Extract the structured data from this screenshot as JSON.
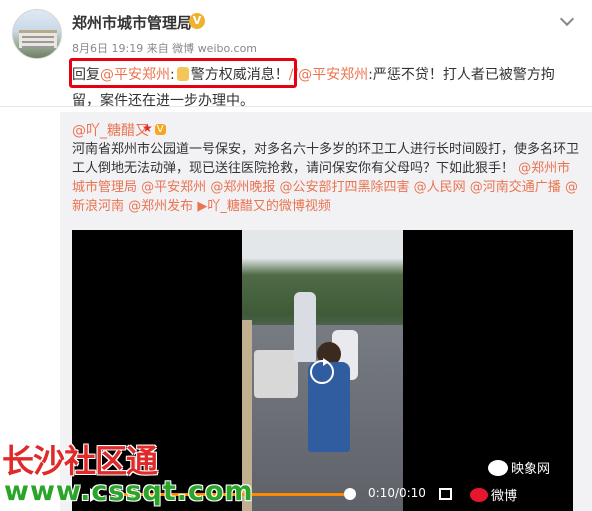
{
  "post": {
    "author": "郑州市城市管理局",
    "verified_mark": "V",
    "meta": "8月6日 19:19 来自 微博 weibo.com",
    "reply_prefix": "回复",
    "mention_1": "@平安郑州",
    "colon": ":",
    "quoted_msg": "警方权威消息！",
    "mention_2": "//@平安郑州",
    "body": ":严惩不贷！打人者已被警方拘留，案件还在进一步办理中。"
  },
  "retweet": {
    "author": "@吖_糖醋又",
    "star": "★",
    "vip": "V",
    "text_plain": "河南省郑州市公园道一号保安，对多名六十多岁的环卫工人进行长时间殴打，使多名环卫工人倒地无法动弹，现已送往医院抢救，请问保安你有父母吗？下如此狠手！",
    "tags": [
      "@郑州市城市管理局",
      "@平安郑州",
      "@郑州晚报",
      "@公安部打四黑除四害",
      "@人民网",
      "@河南交通广播",
      "@新浪河南",
      "@郑州发布"
    ],
    "video_link": "吖_糖醋又的微博视频"
  },
  "video": {
    "time": "0:10/0:10",
    "brand": "微博",
    "progress": 1.0
  },
  "watermarks": {
    "channel": "映象网",
    "site_name": "长沙社区通",
    "site_url": "www.cssqt.com"
  }
}
